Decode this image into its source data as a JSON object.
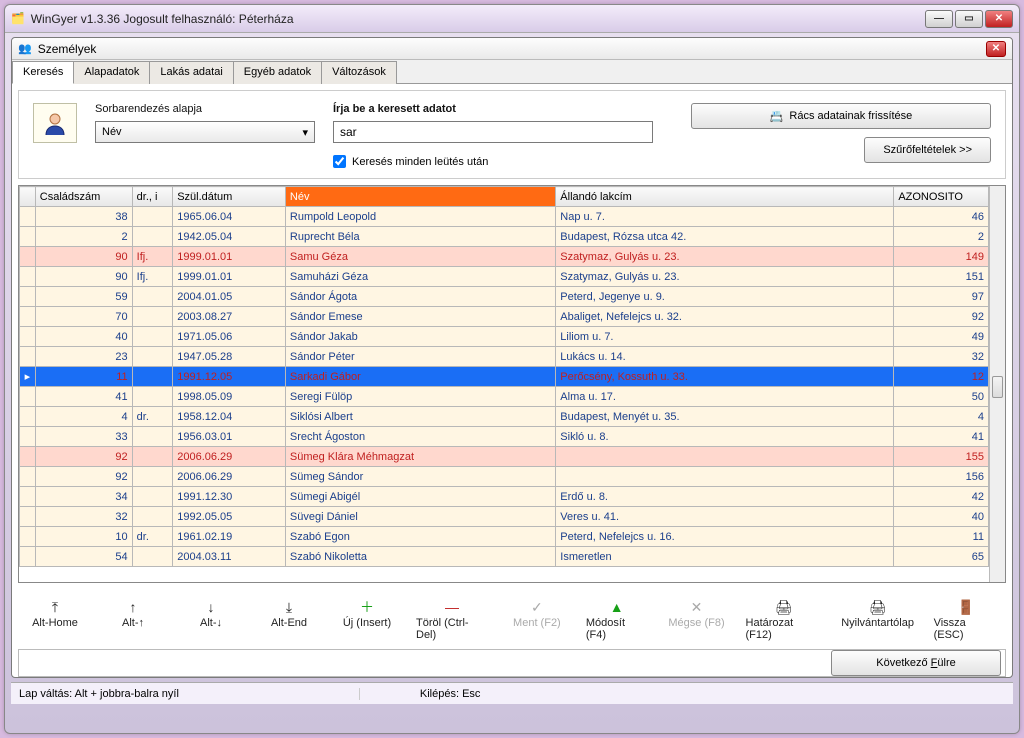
{
  "outer_title": "WinGyer v1.3.36 Jogosult felhasználó: Péterháza",
  "inner_title": "Személyek",
  "tabs": [
    "Keresés",
    "Alapadatok",
    "Lakás adatai",
    "Egyéb adatok",
    "Változások"
  ],
  "search": {
    "sort_label": "Sorbarendezés alapja",
    "sort_value": "Név",
    "input_label": "Írja be a keresett adatot",
    "input_value": "sar",
    "checkbox_label": "Keresés minden leütés után",
    "refresh_btn": "Rács adatainak frissítése",
    "filter_btn": "Szűrőfeltételek >>"
  },
  "grid": {
    "columns": [
      "Családszám",
      "dr., i",
      "Szül.dátum",
      "Név",
      "Állandó lakcím",
      "AZONOSITO"
    ],
    "sorted_col": 3,
    "rows": [
      {
        "style": "light",
        "cs": "38",
        "dr": "",
        "dob": "1965.06.04",
        "nev": "Rumpold Leopold",
        "cim": "Nap u. 7.",
        "az": "46"
      },
      {
        "style": "light",
        "cs": "2",
        "dr": "",
        "dob": "1942.05.04",
        "nev": "Ruprecht Béla",
        "cim": "Budapest, Rózsa utca 42.",
        "az": "2"
      },
      {
        "style": "pink",
        "cs": "90",
        "dr": "Ifj.",
        "dob": "1999.01.01",
        "nev": "Samu Géza",
        "cim": "Szatymaz, Gulyás u. 23.",
        "az": "149",
        "red": true
      },
      {
        "style": "light",
        "cs": "90",
        "dr": "Ifj.",
        "dob": "1999.01.01",
        "nev": "Samuházi Géza",
        "cim": "Szatymaz, Gulyás u. 23.",
        "az": "151"
      },
      {
        "style": "light",
        "cs": "59",
        "dr": "",
        "dob": "2004.01.05",
        "nev": "Sándor Ágota",
        "cim": "Peterd, Jegenye u. 9.",
        "az": "97"
      },
      {
        "style": "light",
        "cs": "70",
        "dr": "",
        "dob": "2003.08.27",
        "nev": "Sándor Emese",
        "cim": "Abaliget, Nefelejcs u. 32.",
        "az": "92"
      },
      {
        "style": "light",
        "cs": "40",
        "dr": "",
        "dob": "1971.05.06",
        "nev": "Sándor Jakab",
        "cim": "Liliom u. 7.",
        "az": "49"
      },
      {
        "style": "light",
        "cs": "23",
        "dr": "",
        "dob": "1947.05.28",
        "nev": "Sándor Péter",
        "cim": "Lukács u. 14.",
        "az": "32"
      },
      {
        "style": "sel",
        "cs": "11",
        "dr": "",
        "dob": "1991.12.05",
        "nev": "Sarkadi Gábor",
        "cim": "Perőcsény, Kossuth u. 33.",
        "az": "12",
        "red": true,
        "marker": true
      },
      {
        "style": "light",
        "cs": "41",
        "dr": "",
        "dob": "1998.05.09",
        "nev": "Seregi Fülöp",
        "cim": "Alma u. 17.",
        "az": "50"
      },
      {
        "style": "light",
        "cs": "4",
        "dr": "dr.",
        "dob": "1958.12.04",
        "nev": "Siklósi Albert",
        "cim": "Budapest, Menyét u. 35.",
        "az": "4"
      },
      {
        "style": "light",
        "cs": "33",
        "dr": "",
        "dob": "1956.03.01",
        "nev": "Srecht Ágoston",
        "cim": "Sikló u. 8.",
        "az": "41"
      },
      {
        "style": "pink",
        "cs": "92",
        "dr": "",
        "dob": "2006.06.29",
        "nev": "Sümeg Klára Méhmagzat",
        "cim": "",
        "az": "155",
        "red": true
      },
      {
        "style": "light",
        "cs": "92",
        "dr": "",
        "dob": "2006.06.29",
        "nev": "Sümeg Sándor",
        "cim": "",
        "az": "156"
      },
      {
        "style": "light",
        "cs": "34",
        "dr": "",
        "dob": "1991.12.30",
        "nev": "Sümegi Abigél",
        "cim": "Erdő u. 8.",
        "az": "42"
      },
      {
        "style": "light",
        "cs": "32",
        "dr": "",
        "dob": "1992.05.05",
        "nev": "Süvegi Dániel",
        "cim": "Veres u. 41.",
        "az": "40"
      },
      {
        "style": "light",
        "cs": "10",
        "dr": "dr.",
        "dob": "1961.02.19",
        "nev": "Szabó Egon",
        "cim": "Peterd, Nefelejcs u. 16.",
        "az": "11"
      },
      {
        "style": "light",
        "cs": "54",
        "dr": "",
        "dob": "2004.03.11",
        "nev": "Szabó Nikoletta",
        "cim": "Ismeretlen",
        "az": "65"
      }
    ]
  },
  "toolbar": [
    {
      "id": "alt-home",
      "label": "Alt-Home",
      "icon": "⤒",
      "enabled": true
    },
    {
      "id": "alt-up",
      "label": "Alt-↑",
      "icon": "↑",
      "enabled": true
    },
    {
      "id": "alt-down",
      "label": "Alt-↓",
      "icon": "↓",
      "enabled": true
    },
    {
      "id": "alt-end",
      "label": "Alt-End",
      "icon": "⤓",
      "enabled": true
    },
    {
      "id": "new",
      "label": "Új (Insert)",
      "icon": "＋",
      "enabled": true,
      "color": "#17a017"
    },
    {
      "id": "delete",
      "label": "Töröl (Ctrl-Del)",
      "icon": "—",
      "enabled": true,
      "color": "#c02020"
    },
    {
      "id": "save",
      "label": "Ment (F2)",
      "icon": "✓",
      "enabled": false
    },
    {
      "id": "modify",
      "label": "Módosít (F4)",
      "icon": "▲",
      "enabled": true,
      "color": "#17a017"
    },
    {
      "id": "cancel",
      "label": "Mégse (F8)",
      "icon": "✕",
      "enabled": false
    },
    {
      "id": "resolution",
      "label": "Határozat (F12)",
      "icon": "🖨",
      "enabled": true
    },
    {
      "id": "sheet",
      "label": "Nyilvántartólap",
      "icon": "🖨",
      "enabled": true
    },
    {
      "id": "back",
      "label": "Vissza (ESC)",
      "icon": "🚪",
      "enabled": true
    }
  ],
  "next_tab_btn": "Következő Fülre",
  "status": {
    "page_switch": "Lap váltás: Alt + jobbra-balra nyíl",
    "exit": "Kilépés: Esc"
  }
}
